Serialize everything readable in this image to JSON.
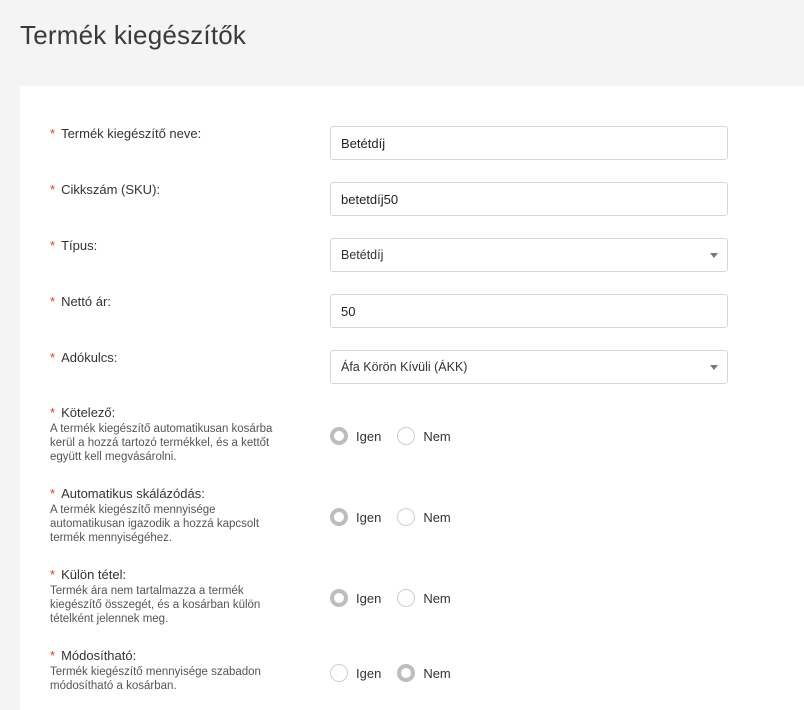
{
  "page": {
    "title": "Termék kiegészítők"
  },
  "form": {
    "name": {
      "label": "Termék kiegészítő neve:",
      "value": "Betétdíj"
    },
    "sku": {
      "label": "Cikkszám (SKU):",
      "value": "betetdíj50"
    },
    "type": {
      "label": "Típus:",
      "value": "Betétdíj"
    },
    "net_price": {
      "label": "Nettó ár:",
      "value": "50"
    },
    "tax": {
      "label": "Adókulcs:",
      "value": "Áfa Körön Kívüli (ÁKK)"
    },
    "required": {
      "label": "Kötelező:",
      "desc": "A termék kiegészítő automatikusan kosárba kerül a hozzá tartozó termékkel, és a kettőt együtt kell megvásárolni.",
      "yes": "Igen",
      "no": "Nem",
      "selected": "Igen"
    },
    "auto_scale": {
      "label": "Automatikus skálázódás:",
      "desc": "A termék kiegészítő mennyisége automatikusan igazodik a hozzá kapcsolt termék mennyiségéhez.",
      "yes": "Igen",
      "no": "Nem",
      "selected": "Igen"
    },
    "separate_item": {
      "label": "Külön tétel:",
      "desc": "Termék ára nem tartalmazza a termék kiegészítő összegét, és a kosárban külön tételként jelennek meg.",
      "yes": "Igen",
      "no": "Nem",
      "selected": "Igen"
    },
    "modifiable": {
      "label": "Módosítható:",
      "desc": "Termék kiegészítő mennyisége szabadon módosítható a kosárban.",
      "yes": "Igen",
      "no": "Nem",
      "selected": "Nem"
    },
    "required_marker": "*"
  }
}
